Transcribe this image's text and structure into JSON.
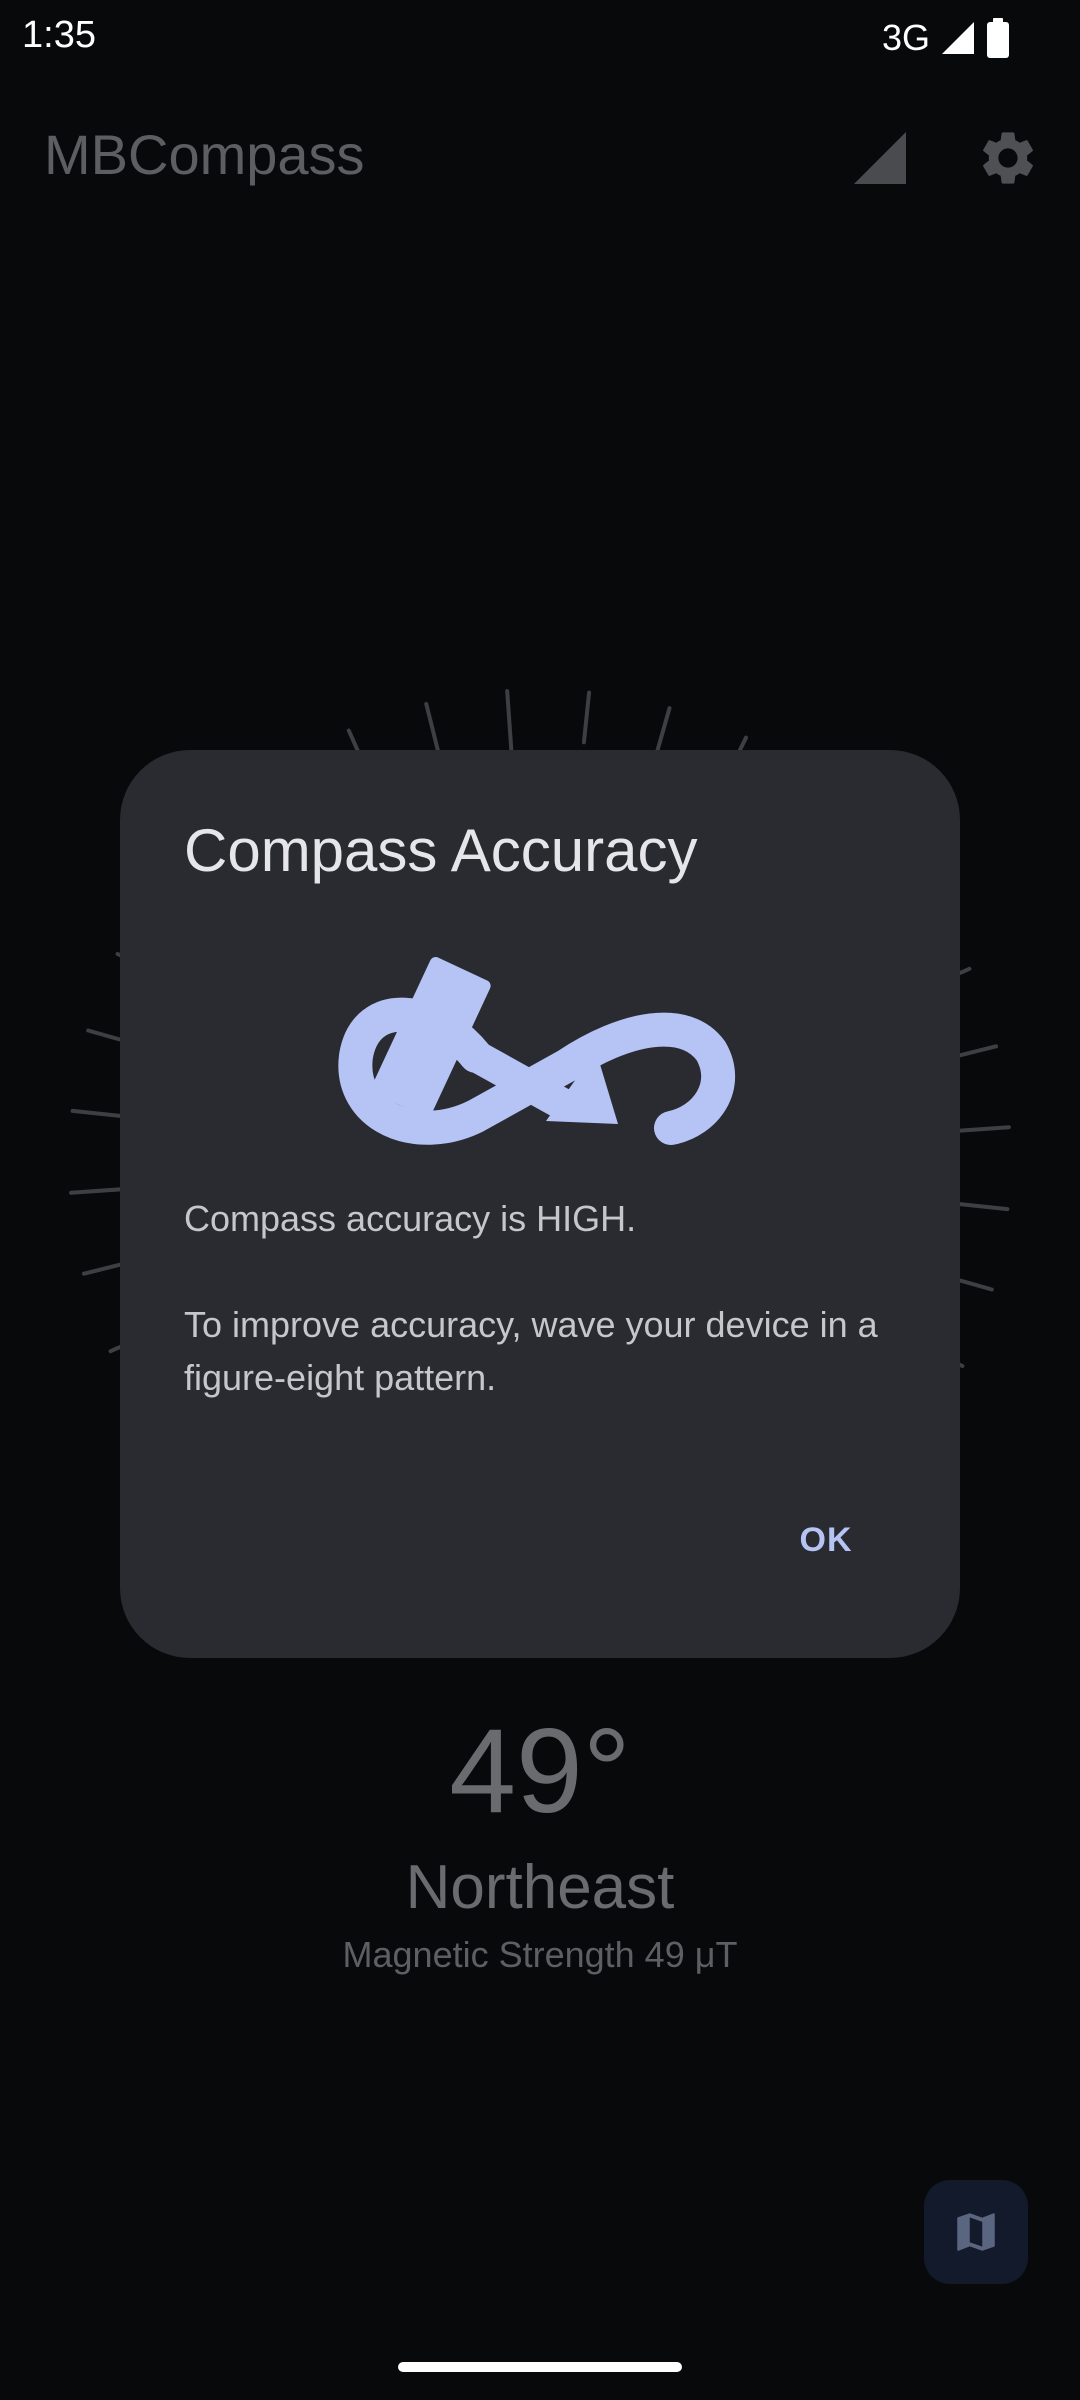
{
  "status_bar": {
    "time": "1:35",
    "network": "3G",
    "icons": [
      "signal-icon",
      "battery-icon"
    ]
  },
  "app_bar": {
    "title": "MBCompass",
    "icons": [
      "accuracy-signal-icon",
      "gear-icon"
    ]
  },
  "compass": {
    "degree": "49°",
    "direction": "Northeast",
    "magnetic_strength": "Magnetic Strength 49 μT"
  },
  "dialog": {
    "title": "Compass Accuracy",
    "illustration": "figure-eight-calibration-icon",
    "status_text": "Compass accuracy is HIGH.",
    "body_text": "To improve accuracy, wave your device in a figure-eight pattern.",
    "ok_label": "OK"
  },
  "fab": {
    "icon": "map-icon"
  },
  "colors": {
    "background": "#08090b",
    "dialog_surface": "#2a2b30",
    "accent": "#b5c4f5",
    "fab_surface": "#121a2b"
  }
}
